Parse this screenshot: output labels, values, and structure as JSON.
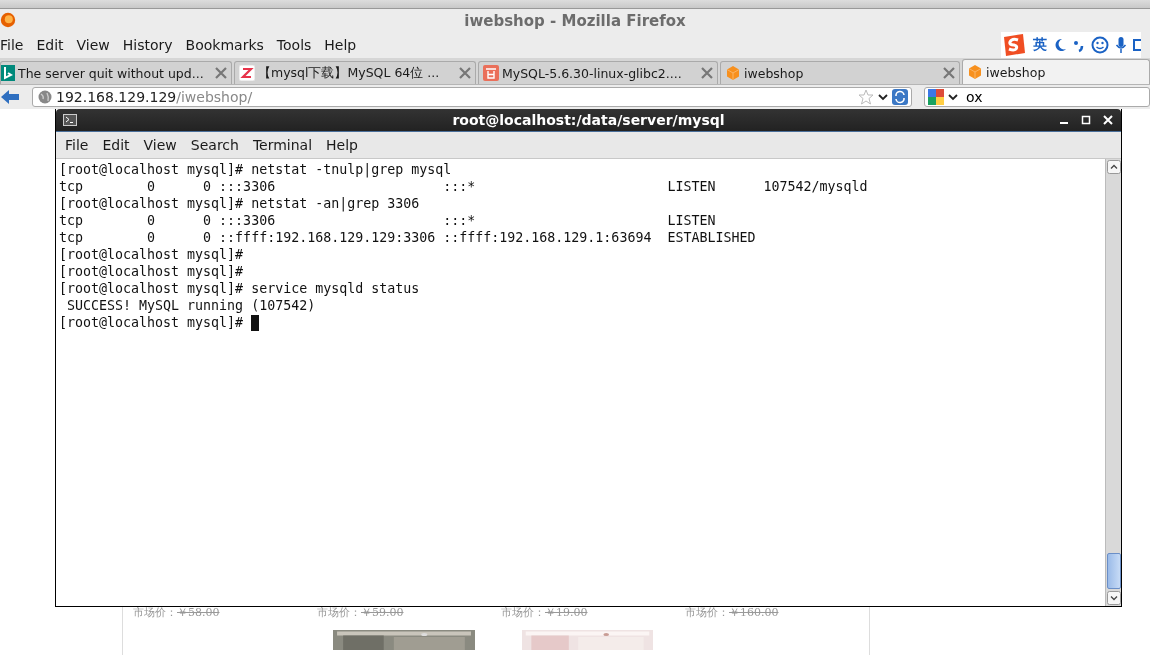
{
  "window": {
    "title": "iwebshop - Mozilla Firefox"
  },
  "menu": [
    "File",
    "Edit",
    "View",
    "History",
    "Bookmarks",
    "Tools",
    "Help"
  ],
  "ime_toolbar": {
    "language": "英"
  },
  "tabs": [
    {
      "label": "The server quit without upd...",
      "selected": false,
      "closable": true
    },
    {
      "label": "【mysql下载】MySQL 64位 ...",
      "selected": false,
      "closable": true
    },
    {
      "label": "MySQL-5.6.30-linux-glibc2....",
      "selected": false,
      "closable": true
    },
    {
      "label": "iwebshop",
      "selected": false,
      "closable": true
    },
    {
      "label": "iwebshop",
      "selected": true,
      "closable": false
    }
  ],
  "address_bar": {
    "host": "192.168.129.129",
    "path": "/iwebshop/"
  },
  "search_bar": {
    "value": "ox"
  },
  "page": {
    "products": [
      {
        "price_label": "市场价：",
        "price": "￥58.00",
        "kind": "text"
      },
      {
        "price_label": "市场价：",
        "price": "￥59.00",
        "kind": "picture"
      },
      {
        "price_label": "市场价：",
        "price": "￥19.00",
        "kind": "picture"
      },
      {
        "price_label": "市场价：",
        "price": "￥160.00",
        "kind": "text"
      }
    ]
  },
  "terminal": {
    "title": "root@localhost:/data/server/mysql",
    "menu": [
      "File",
      "Edit",
      "View",
      "Search",
      "Terminal",
      "Help"
    ],
    "lines": [
      "[root@localhost mysql]# netstat -tnulp|grep mysql",
      "tcp        0      0 :::3306                     :::*                        LISTEN      107542/mysqld",
      "[root@localhost mysql]# netstat -an|grep 3306",
      "tcp        0      0 :::3306                     :::*                        LISTEN",
      "tcp        0      0 ::ffff:192.168.129.129:3306 ::ffff:192.168.129.1:63694  ESTABLISHED",
      "[root@localhost mysql]#",
      "[root@localhost mysql]#",
      "[root@localhost mysql]# service mysqld status",
      " SUCCESS! MySQL running (107542)",
      "[root@localhost mysql]#"
    ],
    "cursor": true
  }
}
